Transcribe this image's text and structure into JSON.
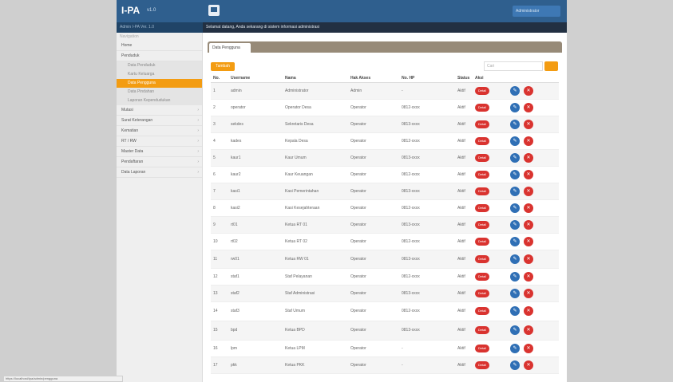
{
  "brand": {
    "title": "I-PA",
    "version": "v1.0",
    "subtitle": "Admin I-PA Ver. 1.0"
  },
  "header": {
    "user_label": "Administrator",
    "welcome_text": "Selamat datang, Anda sekarang di sistem informasi administrasi"
  },
  "sidebar": {
    "heading": "Navigation",
    "items": [
      {
        "label": "Home"
      },
      {
        "label": "Penduduk",
        "subitems": [
          {
            "label": "Data Penduduk",
            "active": false
          },
          {
            "label": "Kartu Keluarga",
            "active": false
          },
          {
            "label": "Data Pengguna",
            "active": true
          },
          {
            "label": "Data Pindahan",
            "active": false
          },
          {
            "label": "Laporan Kependudukan",
            "active": false
          }
        ]
      },
      {
        "label": "Mutasi"
      },
      {
        "label": "Surat Keterangan"
      },
      {
        "label": "Kematian"
      },
      {
        "label": "RT / RW"
      },
      {
        "label": "Master Data"
      },
      {
        "label": "Pendaftaran"
      },
      {
        "label": "Data Laporan"
      }
    ]
  },
  "main": {
    "tab_label": "Data Pengguna",
    "add_button": "Tambah",
    "search_placeholder": "Cari",
    "columns": [
      "No.",
      "Username",
      "Nama",
      "Hak Akses",
      "No. HP",
      "Status",
      "Aksi"
    ],
    "detail_label": "Detail",
    "rows": [
      {
        "no": "1",
        "username": "admin",
        "name": "Administrator",
        "role": "Admin",
        "phone": "-",
        "status": "Aktif"
      },
      {
        "no": "2",
        "username": "operator",
        "name": "Operator Desa",
        "role": "Operator",
        "phone": "0812-xxxx",
        "status": "Aktif"
      },
      {
        "no": "3",
        "username": "sekdes",
        "name": "Sekretaris Desa",
        "role": "Operator",
        "phone": "0813-xxxx",
        "status": "Aktif"
      },
      {
        "no": "4",
        "username": "kades",
        "name": "Kepala Desa",
        "role": "Operator",
        "phone": "0812-xxxx",
        "status": "Aktif"
      },
      {
        "no": "5",
        "username": "kaur1",
        "name": "Kaur Umum",
        "role": "Operator",
        "phone": "0813-xxxx",
        "status": "Aktif"
      },
      {
        "no": "6",
        "username": "kaur2",
        "name": "Kaur Keuangan",
        "role": "Operator",
        "phone": "0812-xxxx",
        "status": "Aktif"
      },
      {
        "no": "7",
        "username": "kasi1",
        "name": "Kasi Pemerintahan",
        "role": "Operator",
        "phone": "0813-xxxx",
        "status": "Aktif"
      },
      {
        "no": "8",
        "username": "kasi2",
        "name": "Kasi Kesejahteraan",
        "role": "Operator",
        "phone": "0812-xxxx",
        "status": "Aktif"
      },
      {
        "no": "9",
        "username": "rt01",
        "name": "Ketua RT 01",
        "role": "Operator",
        "phone": "0813-xxxx",
        "status": "Aktif"
      },
      {
        "no": "10",
        "username": "rt02",
        "name": "Ketua RT 02",
        "role": "Operator",
        "phone": "0812-xxxx",
        "status": "Aktif"
      },
      {
        "no": "11",
        "username": "rw01",
        "name": "Ketua RW 01",
        "role": "Operator",
        "phone": "0813-xxxx",
        "status": "Aktif"
      },
      {
        "no": "12",
        "username": "staf1",
        "name": "Staf Pelayanan",
        "role": "Operator",
        "phone": "0812-xxxx",
        "status": "Aktif"
      },
      {
        "no": "13",
        "username": "staf2",
        "name": "Staf Administrasi",
        "role": "Operator",
        "phone": "0813-xxxx",
        "status": "Aktif"
      },
      {
        "no": "14",
        "username": "staf3",
        "name": "Staf Umum",
        "role": "Operator",
        "phone": "0812-xxxx",
        "status": "Aktif"
      },
      {
        "no": "15",
        "username": "bpd",
        "name": "Ketua BPD",
        "role": "Operator",
        "phone": "0813-xxxx",
        "status": "Aktif"
      },
      {
        "no": "16",
        "username": "lpm",
        "name": "Ketua LPM",
        "role": "Operator",
        "phone": "-",
        "status": "Aktif"
      },
      {
        "no": "17",
        "username": "pkk",
        "name": "Ketua PKK",
        "role": "Operator",
        "phone": "-",
        "status": "Aktif"
      }
    ]
  },
  "status_bar": "https://localhost/ipa/admin/pengguna",
  "colors": {
    "header": "#2f5f8e",
    "accent": "#f39c12",
    "danger": "#d9332f",
    "primary": "#2f6fb5",
    "tabbar": "#978a78"
  }
}
